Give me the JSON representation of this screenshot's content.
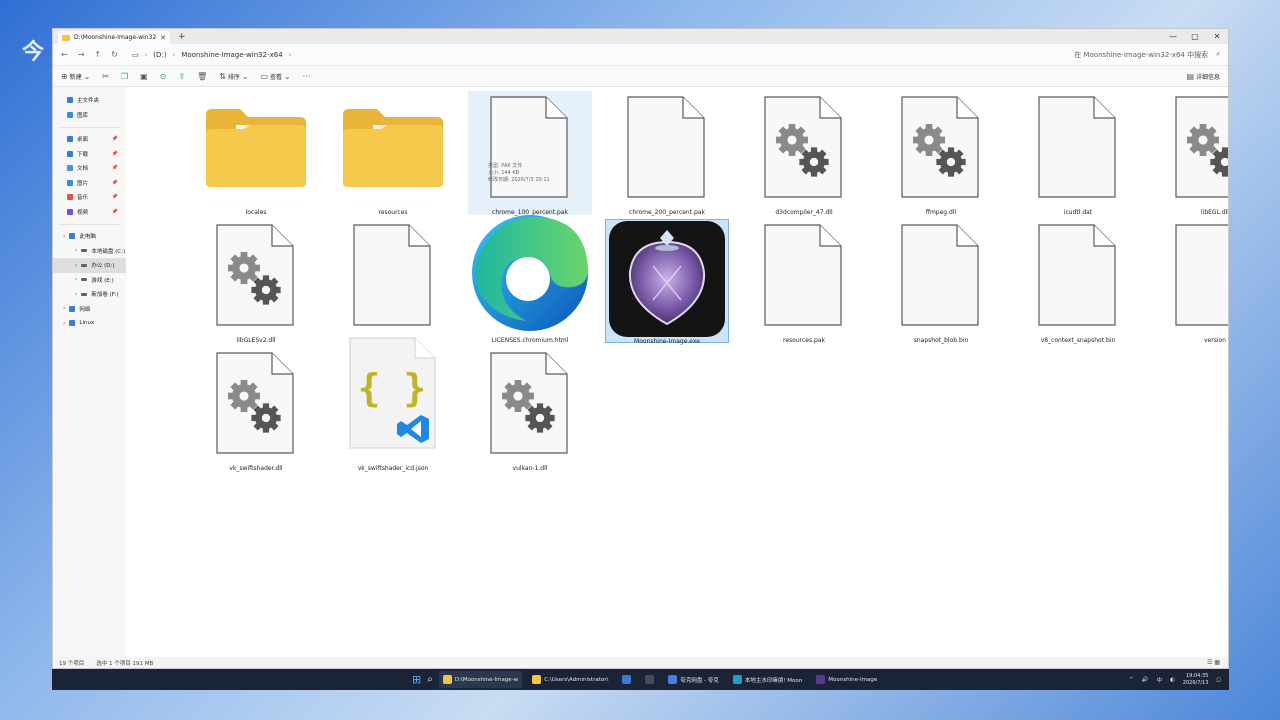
{
  "wallpaper": {
    "mark": "今"
  },
  "window": {
    "tab_title": "D:\\Moonshine-Image-win32-x",
    "controls": {
      "minimize": "—",
      "maximize": "▢",
      "close": "✕"
    }
  },
  "address": {
    "crumbs": [
      "(D:)",
      "Moonshine-Image-win32-x64"
    ],
    "search_placeholder": "在 Moonshine-Image-win32-x64 中搜索"
  },
  "toolbar": {
    "new_label": "新建",
    "sort_label": "排序",
    "view_label": "查看",
    "details_label": "详细信息"
  },
  "sidebar": {
    "items": [
      {
        "label": "主文件夹",
        "color": "#3a7bd5"
      },
      {
        "label": "图库",
        "color": "#2f8fd8"
      },
      {
        "label": "桌面",
        "color": "#3a7bd5",
        "pinned": true
      },
      {
        "label": "下载",
        "color": "#2b7fd4",
        "pinned": true
      },
      {
        "label": "文档",
        "color": "#4e8fe0",
        "pinned": true
      },
      {
        "label": "图片",
        "color": "#3b8ad6",
        "pinned": true
      },
      {
        "label": "音乐",
        "color": "#e0533c",
        "pinned": true
      },
      {
        "label": "视频",
        "color": "#7a4ed6",
        "pinned": true
      }
    ],
    "tree": [
      {
        "label": "此电脑",
        "level": 0
      },
      {
        "label": "本地磁盘 (C:)",
        "level": 1
      },
      {
        "label": "办公 (D:)",
        "level": 1,
        "selected": true
      },
      {
        "label": "游戏 (E:)",
        "level": 1
      },
      {
        "label": "新加卷 (F:)",
        "level": 1
      },
      {
        "label": "网络",
        "level": 0
      },
      {
        "label": "Linux",
        "level": 0
      }
    ]
  },
  "files": [
    {
      "name": "locales",
      "type": "folder"
    },
    {
      "name": "resources",
      "type": "folder"
    },
    {
      "name": "chrome_100_percent.pak",
      "type": "file",
      "state": "hover"
    },
    {
      "name": "chrome_200_percent.pak",
      "type": "file"
    },
    {
      "name": "d3dcompiler_47.dll",
      "type": "dll"
    },
    {
      "name": "ffmpeg.dll",
      "type": "dll"
    },
    {
      "name": "icudtl.dat",
      "type": "file"
    },
    {
      "name": "libEGL.dll",
      "type": "dll"
    },
    {
      "name": "libGLESv2.dll",
      "type": "dll"
    },
    {
      "name": "LICENSE",
      "type": "file"
    },
    {
      "name": "LICENSES.chromium.html",
      "type": "edge"
    },
    {
      "name": "Moonshine-Image.exe",
      "type": "app",
      "state": "selected"
    },
    {
      "name": "resources.pak",
      "type": "file"
    },
    {
      "name": "snapshot_blob.bin",
      "type": "file"
    },
    {
      "name": "v8_context_snapshot.bin",
      "type": "file"
    },
    {
      "name": "version",
      "type": "file"
    },
    {
      "name": "vk_swiftshader.dll",
      "type": "dll"
    },
    {
      "name": "vk_swiftshader_icd.json",
      "type": "json"
    },
    {
      "name": "vulkan-1.dll",
      "type": "dll"
    }
  ],
  "tooltip": {
    "line1": "类型: PAK 文件",
    "line2": "大小: 144 KB",
    "line3": "修改日期: 2026/7/3 20:11"
  },
  "status": {
    "count": "19 个项目",
    "selection": "选中 1 个项目  191 MB"
  },
  "taskbar": {
    "apps": [
      {
        "label": "D:\\Moonshine-Image-w",
        "color": "#f3c448",
        "active": true
      },
      {
        "label": "C:\\Users\\Administrator\\",
        "color": "#f3c448"
      },
      {
        "label": "",
        "color": "#3a7bd5"
      },
      {
        "label": "",
        "color": "#444c5c"
      },
      {
        "label": "夸克网盘 - 夸克",
        "color": "#4a7fe0"
      },
      {
        "label": "本地主水印嘛朋! Moon",
        "color": "#1fa0c8"
      },
      {
        "label": "Moonshine-Image",
        "color": "#5c3b8a"
      }
    ],
    "tray": {
      "ime": "中",
      "time": "19:04:35",
      "date": "2026/7/13"
    }
  }
}
